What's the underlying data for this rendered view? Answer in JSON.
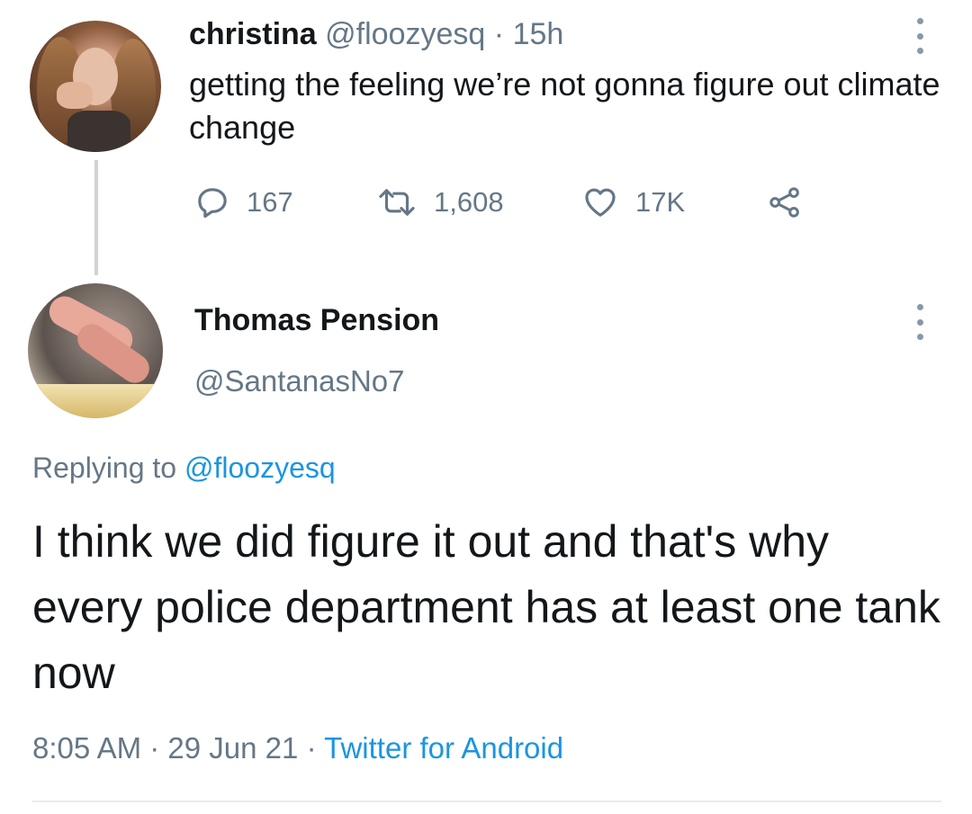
{
  "tweet1": {
    "author_name": "christina",
    "author_handle": "@floozyesq",
    "separator": "·",
    "time": "15h",
    "text": "getting the feeling we’re not gonna figure out climate change",
    "replies": "167",
    "retweets": "1,608",
    "likes": "17K"
  },
  "tweet2": {
    "author_name": "Thomas Pension",
    "author_handle": "@SantanasNo7",
    "replying_prefix": "Replying to",
    "replying_handle": "@floozyesq",
    "text": "I think we did figure it out and that's why every police department has at least one tank now",
    "time": "8:05 AM",
    "date": "29 Jun 21",
    "separator": "·",
    "source": "Twitter for Android"
  },
  "icons": {
    "reply": "reply-icon",
    "retweet": "retweet-icon",
    "like": "heart-icon",
    "share": "share-icon",
    "more": "more-vertical-icon"
  },
  "colors": {
    "text": "#14171a",
    "muted": "#657786",
    "link": "#1b95e0",
    "thread_line": "#cdd3d8"
  }
}
